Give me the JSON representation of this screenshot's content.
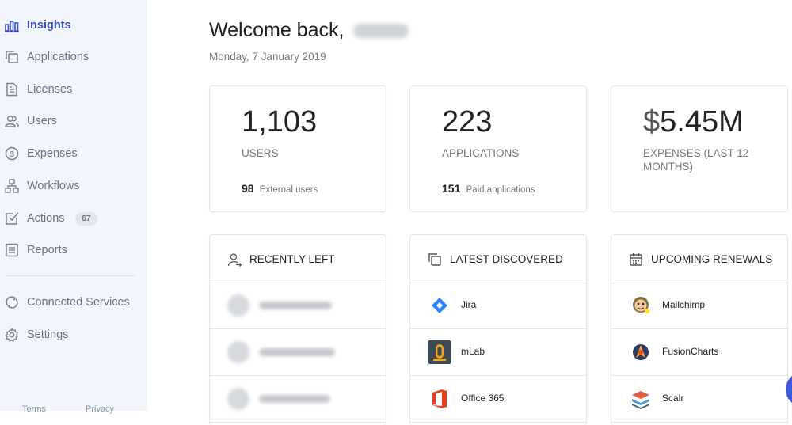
{
  "sidebar": {
    "items": [
      {
        "label": "Insights",
        "icon": "bar-chart-icon",
        "active": true
      },
      {
        "label": "Applications",
        "icon": "copy-icon"
      },
      {
        "label": "Licenses",
        "icon": "document-icon"
      },
      {
        "label": "Users",
        "icon": "users-icon"
      },
      {
        "label": "Expenses",
        "icon": "dollar-icon"
      },
      {
        "label": "Workflows",
        "icon": "workflow-icon"
      },
      {
        "label": "Actions",
        "icon": "check-square-icon",
        "badge": "67"
      },
      {
        "label": "Reports",
        "icon": "report-icon"
      }
    ],
    "secondary": [
      {
        "label": "Connected Services",
        "icon": "sync-icon"
      },
      {
        "label": "Settings",
        "icon": "gear-icon"
      }
    ],
    "footer": {
      "terms": "Terms",
      "privacy": "Privacy"
    }
  },
  "header": {
    "welcome": "Welcome back,",
    "date": "Monday, 7 January 2019"
  },
  "stats": [
    {
      "value": "1,103",
      "label": "USERS",
      "sub_value": "98",
      "sub_label": "External users"
    },
    {
      "value": "223",
      "label": "APPLICATIONS",
      "sub_value": "151",
      "sub_label": "Paid applications"
    },
    {
      "currency": "$",
      "value": "5.45M",
      "label": "EXPENSES (LAST 12 MONTHS)"
    }
  ],
  "panels": {
    "recently_left": {
      "title": "RECENTLY LEFT",
      "icon": "user-leave-icon"
    },
    "latest_discovered": {
      "title": "LATEST DISCOVERED",
      "icon": "copy-icon",
      "items": [
        {
          "name": "Jira",
          "icon": "jira-icon"
        },
        {
          "name": "mLab",
          "icon": "mlab-icon"
        },
        {
          "name": "Office 365",
          "icon": "office-icon"
        }
      ]
    },
    "upcoming_renewals": {
      "title": "UPCOMING RENEWALS",
      "icon": "calendar-icon",
      "items": [
        {
          "name": "Mailchimp",
          "icon": "mailchimp-icon"
        },
        {
          "name": "FusionCharts",
          "icon": "fusioncharts-icon"
        },
        {
          "name": "Scalr",
          "icon": "scalr-icon"
        }
      ]
    }
  },
  "colors": {
    "accent": "#3b4fc4",
    "sidebar_bg": "#f2f5fb",
    "muted": "#6b7280",
    "border": "#e3e6eb"
  }
}
